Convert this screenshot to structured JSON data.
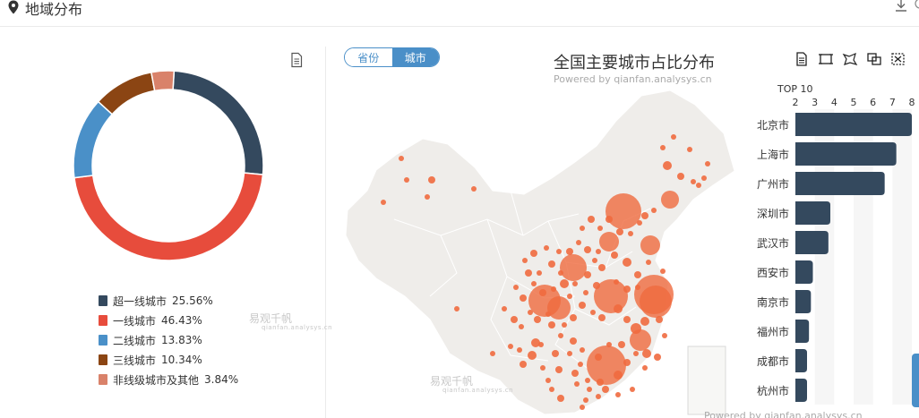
{
  "header": {
    "title": "地域分布"
  },
  "toggle": {
    "province": "省份",
    "city": "城市"
  },
  "donut": {
    "colors": [
      "#34495e",
      "#e74c3c",
      "#4a90c8",
      "#8b4513",
      "#d9826a"
    ],
    "legend": [
      {
        "name": "超一线城市",
        "value": "25.56%",
        "color": "#34495e"
      },
      {
        "name": "一线城市",
        "value": "46.43%",
        "color": "#e74c3c"
      },
      {
        "name": "二线城市",
        "value": "13.83%",
        "color": "#4a90c8"
      },
      {
        "name": "三线城市",
        "value": "10.34%",
        "color": "#8b4513"
      },
      {
        "name": "非线级城市及其他",
        "value": "3.84%",
        "color": "#d9826a"
      }
    ]
  },
  "watermark": {
    "brand": "易观千帆",
    "site": "qianfan.analysys.cn"
  },
  "map": {
    "title": "全国主要城市占比分布",
    "subtitle": "Powered by qianfan.analysys.cn",
    "footer": "Powered by qianfan.analysys.cn",
    "bubble_color": "#ef6a3f"
  },
  "chart_data": {
    "type": "bar",
    "title": "TOP 10",
    "categories": [
      "北京市",
      "上海市",
      "广州市",
      "深圳市",
      "武汉市",
      "西安市",
      "南京市",
      "福州市",
      "成都市",
      "杭州市"
    ],
    "values": [
      8.0,
      7.2,
      6.6,
      3.8,
      3.7,
      2.9,
      2.8,
      2.7,
      2.6,
      2.6
    ],
    "xlim": [
      2,
      8
    ],
    "xticks": [
      2,
      3,
      4,
      5,
      6,
      7,
      8
    ],
    "bar_color": "#34495e",
    "donut": {
      "type": "pie",
      "categories": [
        "超一线城市",
        "一线城市",
        "二线城市",
        "三线城市",
        "非线级城市及其他"
      ],
      "values": [
        25.56,
        46.43,
        13.83,
        10.34,
        3.84
      ]
    }
  }
}
